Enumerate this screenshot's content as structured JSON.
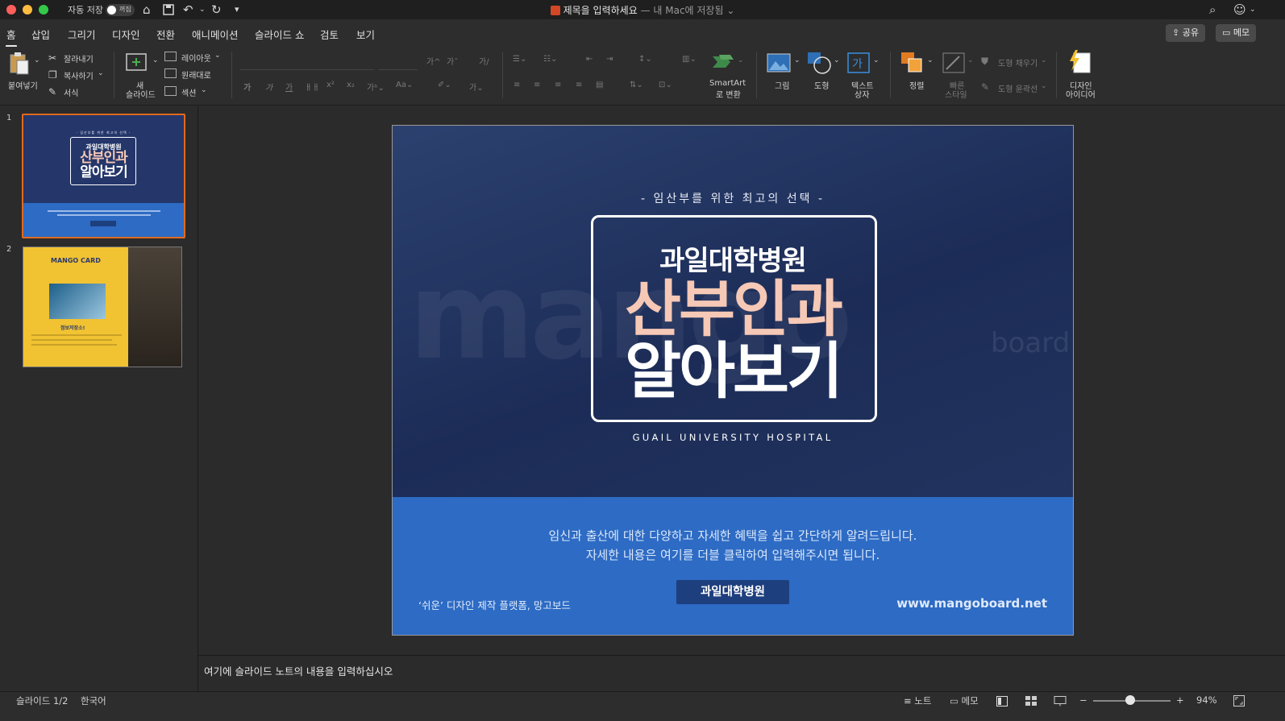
{
  "titlebar": {
    "autosave_label": "자동 저장",
    "autosave_state": "꺼짐",
    "doc_title": "제목을 입력하세요",
    "doc_subtitle": "— 내 Mac에 저장됨"
  },
  "tabs": [
    "홈",
    "삽입",
    "그리기",
    "디자인",
    "전환",
    "애니메이션",
    "슬라이드 쇼",
    "검토",
    "보기"
  ],
  "top_right": {
    "share": "공유",
    "comment": "메모"
  },
  "ribbon": {
    "paste": "붙여넣기",
    "cut": "잘라내기",
    "copy": "복사하기",
    "format": "서식",
    "new_slide_1": "새",
    "new_slide_2": "슬라이드",
    "layout": "레이아웃",
    "reset": "원래대로",
    "section": "섹션",
    "font_buttons": [
      "가",
      "가",
      "가",
      "ㅐㅐ",
      "x²",
      "x₂"
    ],
    "smartart_1": "SmartArt",
    "smartart_2": "로 변환",
    "picture": "그림",
    "shape": "도형",
    "textbox_1": "텍스트",
    "textbox_2": "상자",
    "arrange": "정렬",
    "quick_style_1": "빠른",
    "quick_style_2": "스타일",
    "shape_fill": "도형 채우기",
    "shape_outline": "도형 윤곽선",
    "design_ideas_1": "디자인",
    "design_ideas_2": "아이디어"
  },
  "thumbnails": {
    "nums": [
      "1",
      "2"
    ],
    "t1_sub": "- 임산부를 위한 최고의 선택 -",
    "t1_hospital": "과일대학병원",
    "t1_main1": "산부인과",
    "t1_main2": "알아보기",
    "t2_header": "MANGO CARD",
    "t2_label": "정보저장소!"
  },
  "slide": {
    "subtitle": "- 임산부를 위한 최고의 선택 -",
    "hospital": "과일대학병원",
    "main1": "산부인과",
    "main2": "알아보기",
    "english": "GUAIL UNIVERSITY HOSPITAL",
    "desc1": "임신과 출산에 대한 다양하고 자세한 혜택을 쉽고 간단하게 알려드립니다.",
    "desc2": "자세한 내용은 여기를 더블 클릭하여 입력해주시면 됩니다.",
    "button": "과일대학병원",
    "footer_left": "‘쉬운’ 디자인 제작 플랫폼, 망고보드",
    "footer_right": "www.mangoboard.net",
    "watermark": "mango",
    "watermark2": "board"
  },
  "notes_placeholder": "여기에 슬라이드 노트의 내용을 입력하십시오",
  "status": {
    "slide_count": "슬라이드 1/2",
    "language": "한국어",
    "notes": "노트",
    "comments": "메모",
    "zoom_minus": "−",
    "zoom_plus": "+",
    "zoom": "94%"
  },
  "colors": {
    "accent": "#e2691e",
    "slide_bg": "#1f3060",
    "slide_bottom": "#2d6bc4",
    "title_pink": "#f6c8b6",
    "button_bg": "#1e3f7e"
  }
}
